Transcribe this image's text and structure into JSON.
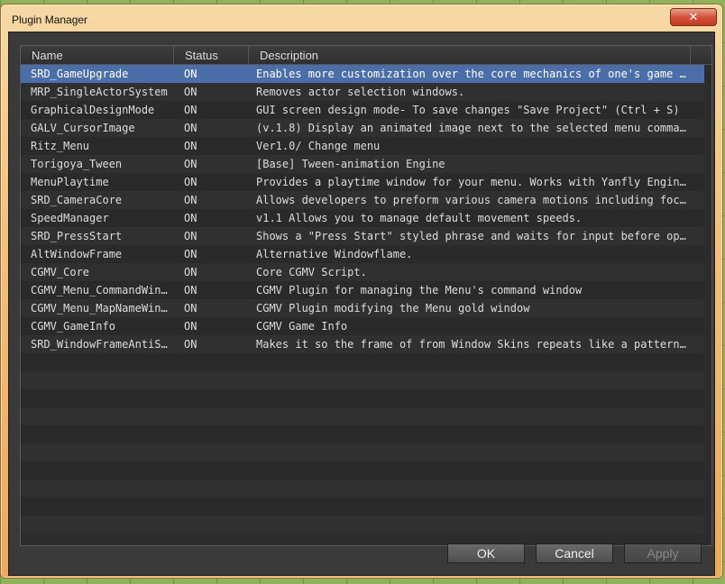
{
  "window": {
    "title": "Plugin Manager",
    "close_glyph": "✕"
  },
  "columns": {
    "name": "Name",
    "status": "Status",
    "description": "Description"
  },
  "plugins": [
    {
      "name": "SRD_GameUpgrade",
      "status": "ON",
      "description": "Enables more customization over the core mechanics of one's game w…"
    },
    {
      "name": "MRP_SingleActorSystem",
      "status": "ON",
      "description": "Removes actor selection windows."
    },
    {
      "name": "GraphicalDesignMode",
      "status": "ON",
      "description": "GUI screen design mode- To save changes \"Save Project\" (Ctrl + S)"
    },
    {
      "name": "GALV_CursorImage",
      "status": "ON",
      "description": "(v.1.8) Display an animated image next to the selected menu command."
    },
    {
      "name": "Ritz_Menu",
      "status": "ON",
      "description": "Ver1.0/ Change menu"
    },
    {
      "name": "Torigoya_Tween",
      "status": "ON",
      "description": "[Base] Tween-animation Engine"
    },
    {
      "name": "MenuPlaytime",
      "status": "ON",
      "description": "Provides a playtime window for your menu. Works with Yanfly Engine…"
    },
    {
      "name": "SRD_CameraCore",
      "status": "ON",
      "description": "Allows developers to preform various camera motions including focu…"
    },
    {
      "name": "SpeedManager",
      "status": "ON",
      "description": "v1.1 Allows you to manage default movement speeds."
    },
    {
      "name": "SRD_PressStart",
      "status": "ON",
      "description": "Shows a \"Press Start\" styled phrase and waits for input before ope…"
    },
    {
      "name": "AltWindowFrame",
      "status": "ON",
      "description": "Alternative Windowflame."
    },
    {
      "name": "CGMV_Core",
      "status": "ON",
      "description": "Core CGMV Script."
    },
    {
      "name": "CGMV_Menu_CommandWin…",
      "status": "ON",
      "description": "CGMV Plugin for managing the Menu's command window"
    },
    {
      "name": "CGMV_Menu_MapNameWin…",
      "status": "ON",
      "description": "CGMV Plugin modifying the Menu gold window"
    },
    {
      "name": "CGMV_GameInfo",
      "status": "ON",
      "description": "CGMV Game Info"
    },
    {
      "name": "SRD_WindowFrameAntiS…",
      "status": "ON",
      "description": "Makes it so the frame of from Window Skins repeats like a pattern …"
    }
  ],
  "empty_rows": 10,
  "buttons": {
    "ok": "OK",
    "cancel": "Cancel",
    "apply": "Apply"
  },
  "colors": {
    "selection": "#4b6ea8",
    "title_bar": "#f3c07b",
    "close": "#d2533a"
  }
}
